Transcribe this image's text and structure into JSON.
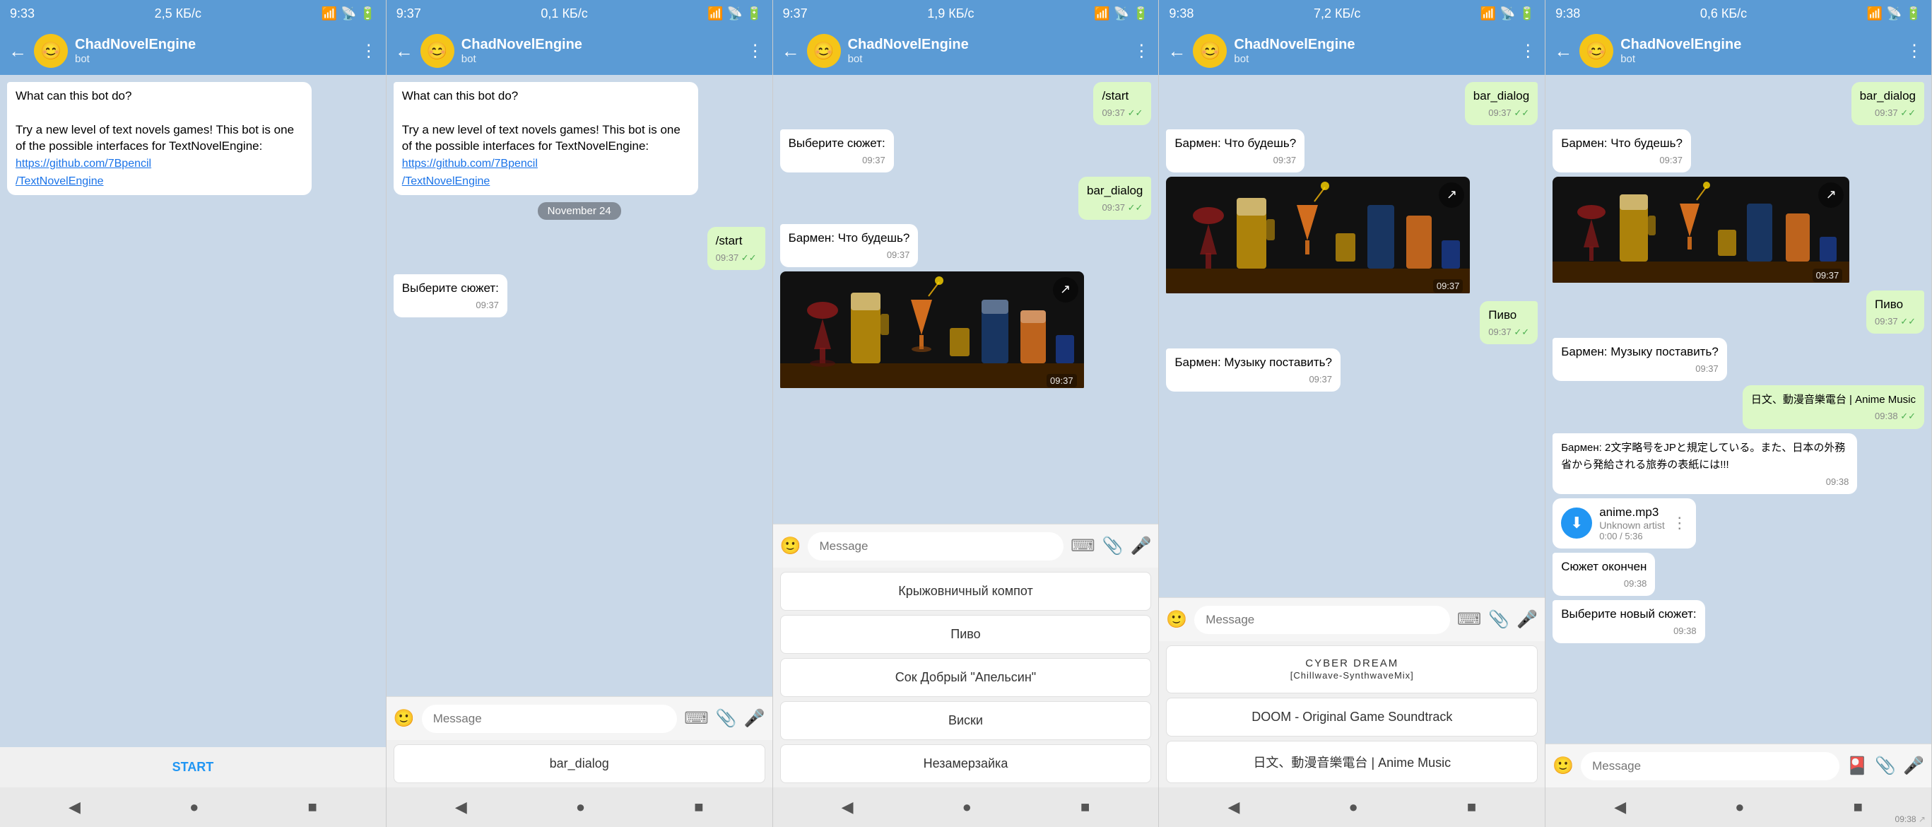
{
  "panels": [
    {
      "id": "panel1",
      "statusBar": {
        "time": "9:33",
        "info": "2,5 КБ/с",
        "clockIcon": "🕐"
      },
      "header": {
        "botName": "ChadNovelEngine",
        "botStatus": "bot"
      },
      "messages": [
        {
          "type": "incoming",
          "text": "What can this bot do?\n\nTry a new level of text novels games! This bot is one of the possible interfaces for TextNovelEngine:\nhttps://github.com/7Bpencil/TextNovelEngine",
          "hasLink": true,
          "linkText": "https://github.com/7Bpencil\n/TextNovelEngine",
          "time": ""
        }
      ],
      "keyboard": [
        {
          "label": "START"
        }
      ],
      "keyboardType": "start"
    },
    {
      "id": "panel2",
      "statusBar": {
        "time": "9:37",
        "info": "0,1 КБ/с"
      },
      "header": {
        "botName": "ChadNovelEngine",
        "botStatus": "bot"
      },
      "messages": [
        {
          "type": "incoming",
          "text": "What can this bot do?\n\nTry a new level of text novels games! This bot is one of the possible interfaces for TextNovelEngine:\nhttps://github.com/7Bpencil/TextNovelEngine",
          "hasLink": true,
          "time": ""
        },
        {
          "type": "date",
          "text": "November 24"
        },
        {
          "type": "outgoing",
          "text": "/start",
          "time": "09:37",
          "check": true
        },
        {
          "type": "incoming",
          "text": "Выберите сюжет:",
          "time": "09:37"
        }
      ],
      "keyboard": [
        {
          "label": "bar_dialog"
        }
      ],
      "keyboardType": "normal"
    },
    {
      "id": "panel3",
      "statusBar": {
        "time": "9:37",
        "info": "1,9 КБ/с"
      },
      "header": {
        "botName": "ChadNovelEngine",
        "botStatus": "bot"
      },
      "messages": [
        {
          "type": "outgoing",
          "text": "/start",
          "time": "09:37",
          "check": true
        },
        {
          "type": "incoming",
          "text": "Выберите сюжет:",
          "time": "09:37"
        },
        {
          "type": "outgoing",
          "text": "bar_dialog",
          "time": "09:37",
          "check": true
        },
        {
          "type": "incoming",
          "text": "Бармен: Что будешь?",
          "time": "09:37"
        },
        {
          "type": "image",
          "time": "09:37"
        }
      ],
      "keyboard": [
        {
          "label": "Крыжовничный компот"
        },
        {
          "label": "Пиво"
        },
        {
          "label": "Сок Добрый \"Апельсин\""
        },
        {
          "label": "Виски"
        },
        {
          "label": "Незамерзайка"
        }
      ],
      "keyboardType": "normal"
    },
    {
      "id": "panel4",
      "statusBar": {
        "time": "9:38",
        "info": "7,2 КБ/с"
      },
      "header": {
        "botName": "ChadNovelEngine",
        "botStatus": "bot"
      },
      "messages": [
        {
          "type": "outgoing",
          "text": "bar_dialog",
          "time": "09:37",
          "check": true
        },
        {
          "type": "incoming",
          "text": "Бармен: Что будешь?",
          "time": "09:37"
        },
        {
          "type": "image",
          "time": "09:37"
        },
        {
          "type": "outgoing",
          "text": "Пиво",
          "time": "09:37",
          "check": true
        },
        {
          "type": "incoming",
          "text": "Бармен: Музыку поставить?",
          "time": "09:37"
        }
      ],
      "keyboard": [
        {
          "label": "CYBER DREAM\n[Chillwave-SynthwaveMix]"
        },
        {
          "label": "DOOM - Original Game Soundtrack"
        },
        {
          "label": "日文、動漫音樂電台 | Anime Music"
        }
      ],
      "keyboardType": "normal"
    },
    {
      "id": "panel5",
      "statusBar": {
        "time": "9:38",
        "info": "0,6 КБ/с"
      },
      "header": {
        "botName": "ChadNovelEngine",
        "botStatus": "bot"
      },
      "messages": [
        {
          "type": "outgoing",
          "text": "bar_dialog",
          "time": "09:37",
          "check": true
        },
        {
          "type": "incoming",
          "text": "Бармен: Что будешь?",
          "time": "09:37"
        },
        {
          "type": "image",
          "time": "09:37"
        },
        {
          "type": "outgoing",
          "text": "Пиво",
          "time": "09:37",
          "check": true
        },
        {
          "type": "incoming",
          "text": "Бармен: Музыку поставить?",
          "time": "09:37"
        },
        {
          "type": "outgoing",
          "text": "日文、動漫音樂電台 | Anime Music",
          "time": "09:38",
          "check": true
        },
        {
          "type": "incoming",
          "text": "Бармен: 2文字略号をJPと規定している。また、日本の外務省から発給される旅券の表紙には!!!",
          "time": "09:38"
        },
        {
          "type": "audio",
          "title": "anime.mp3",
          "artist": "Unknown artist",
          "duration": "5:36",
          "currentTime": "0:00",
          "time": "09:38"
        },
        {
          "type": "incoming",
          "text": "Сюжет окончен",
          "time": "09:38"
        },
        {
          "type": "incoming",
          "text": "Выберите новый сюжет:",
          "time": "09:38"
        }
      ],
      "keyboard": [],
      "keyboardType": "none"
    }
  ],
  "icons": {
    "back": "←",
    "more": "⋮",
    "emoji": "🙂",
    "attach": "📎",
    "mic": "🎤",
    "keyboard": "⌨",
    "share": "↗",
    "play": "▶",
    "navBack": "◀",
    "navHome": "●",
    "navSquare": "■",
    "signal": "📶",
    "wifi": "📡",
    "battery": "🔋",
    "download": "⬇"
  }
}
